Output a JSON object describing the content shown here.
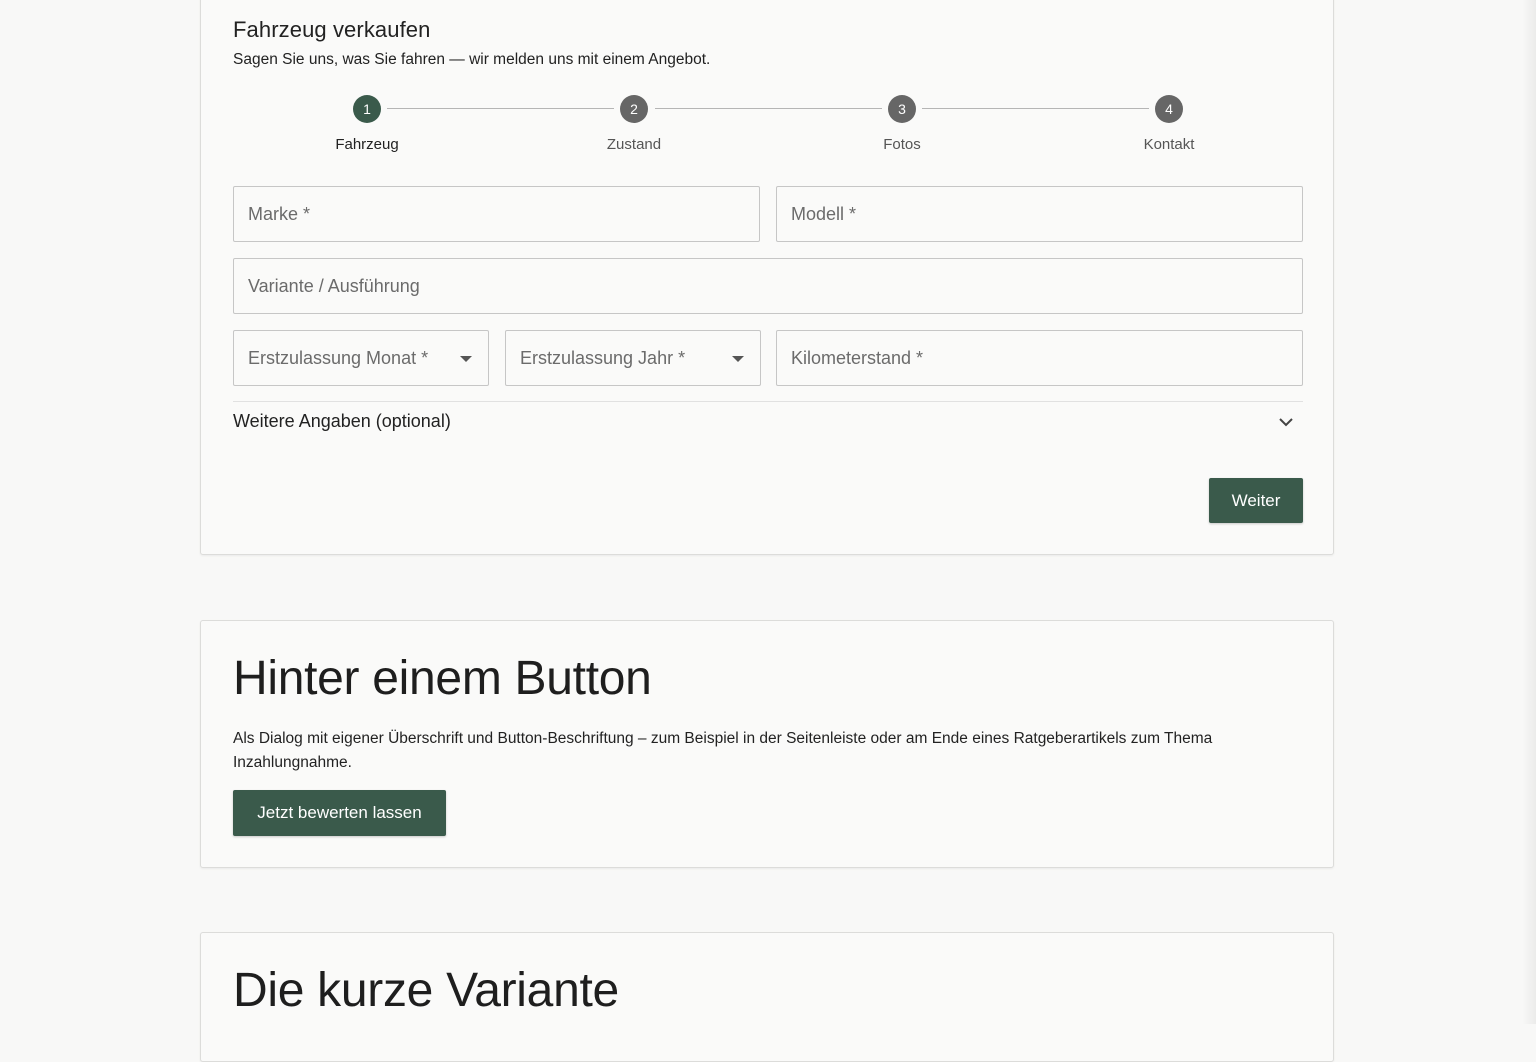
{
  "form": {
    "title": "Fahrzeug verkaufen",
    "subtitle": "Sagen Sie uns, was Sie fahren — wir melden uns mit einem Angebot.",
    "steps": [
      {
        "number": "1",
        "label": "Fahrzeug",
        "active": true
      },
      {
        "number": "2",
        "label": "Zustand",
        "active": false
      },
      {
        "number": "3",
        "label": "Fotos",
        "active": false
      },
      {
        "number": "4",
        "label": "Kontakt",
        "active": false
      }
    ],
    "fields": {
      "marke": {
        "label": "Marke *",
        "value": ""
      },
      "modell": {
        "label": "Modell *",
        "value": ""
      },
      "variante": {
        "label": "Variante / Ausführung",
        "value": ""
      },
      "monat": {
        "label": "Erstzulassung Monat *",
        "value": ""
      },
      "jahr": {
        "label": "Erstzulassung Jahr *",
        "value": ""
      },
      "kilometer": {
        "label": "Kilometerstand *",
        "value": ""
      }
    },
    "accordion_label": "Weitere Angaben (optional)",
    "next_button": "Weiter"
  },
  "button_section": {
    "title": "Hinter einem Button",
    "text": "Als Dialog mit eigener Überschrift und Button-Beschriftung – zum Beispiel in der Seitenleiste oder am Ende eines Ratgeberartikels zum Thema Inzahlungnahme.",
    "button_label": "Jetzt bewerten lassen"
  },
  "short_section": {
    "title": "Die kurze Variante"
  },
  "colors": {
    "accent": "#3a5a4b",
    "step_inactive": "#666666",
    "background": "#f8f8f7"
  }
}
